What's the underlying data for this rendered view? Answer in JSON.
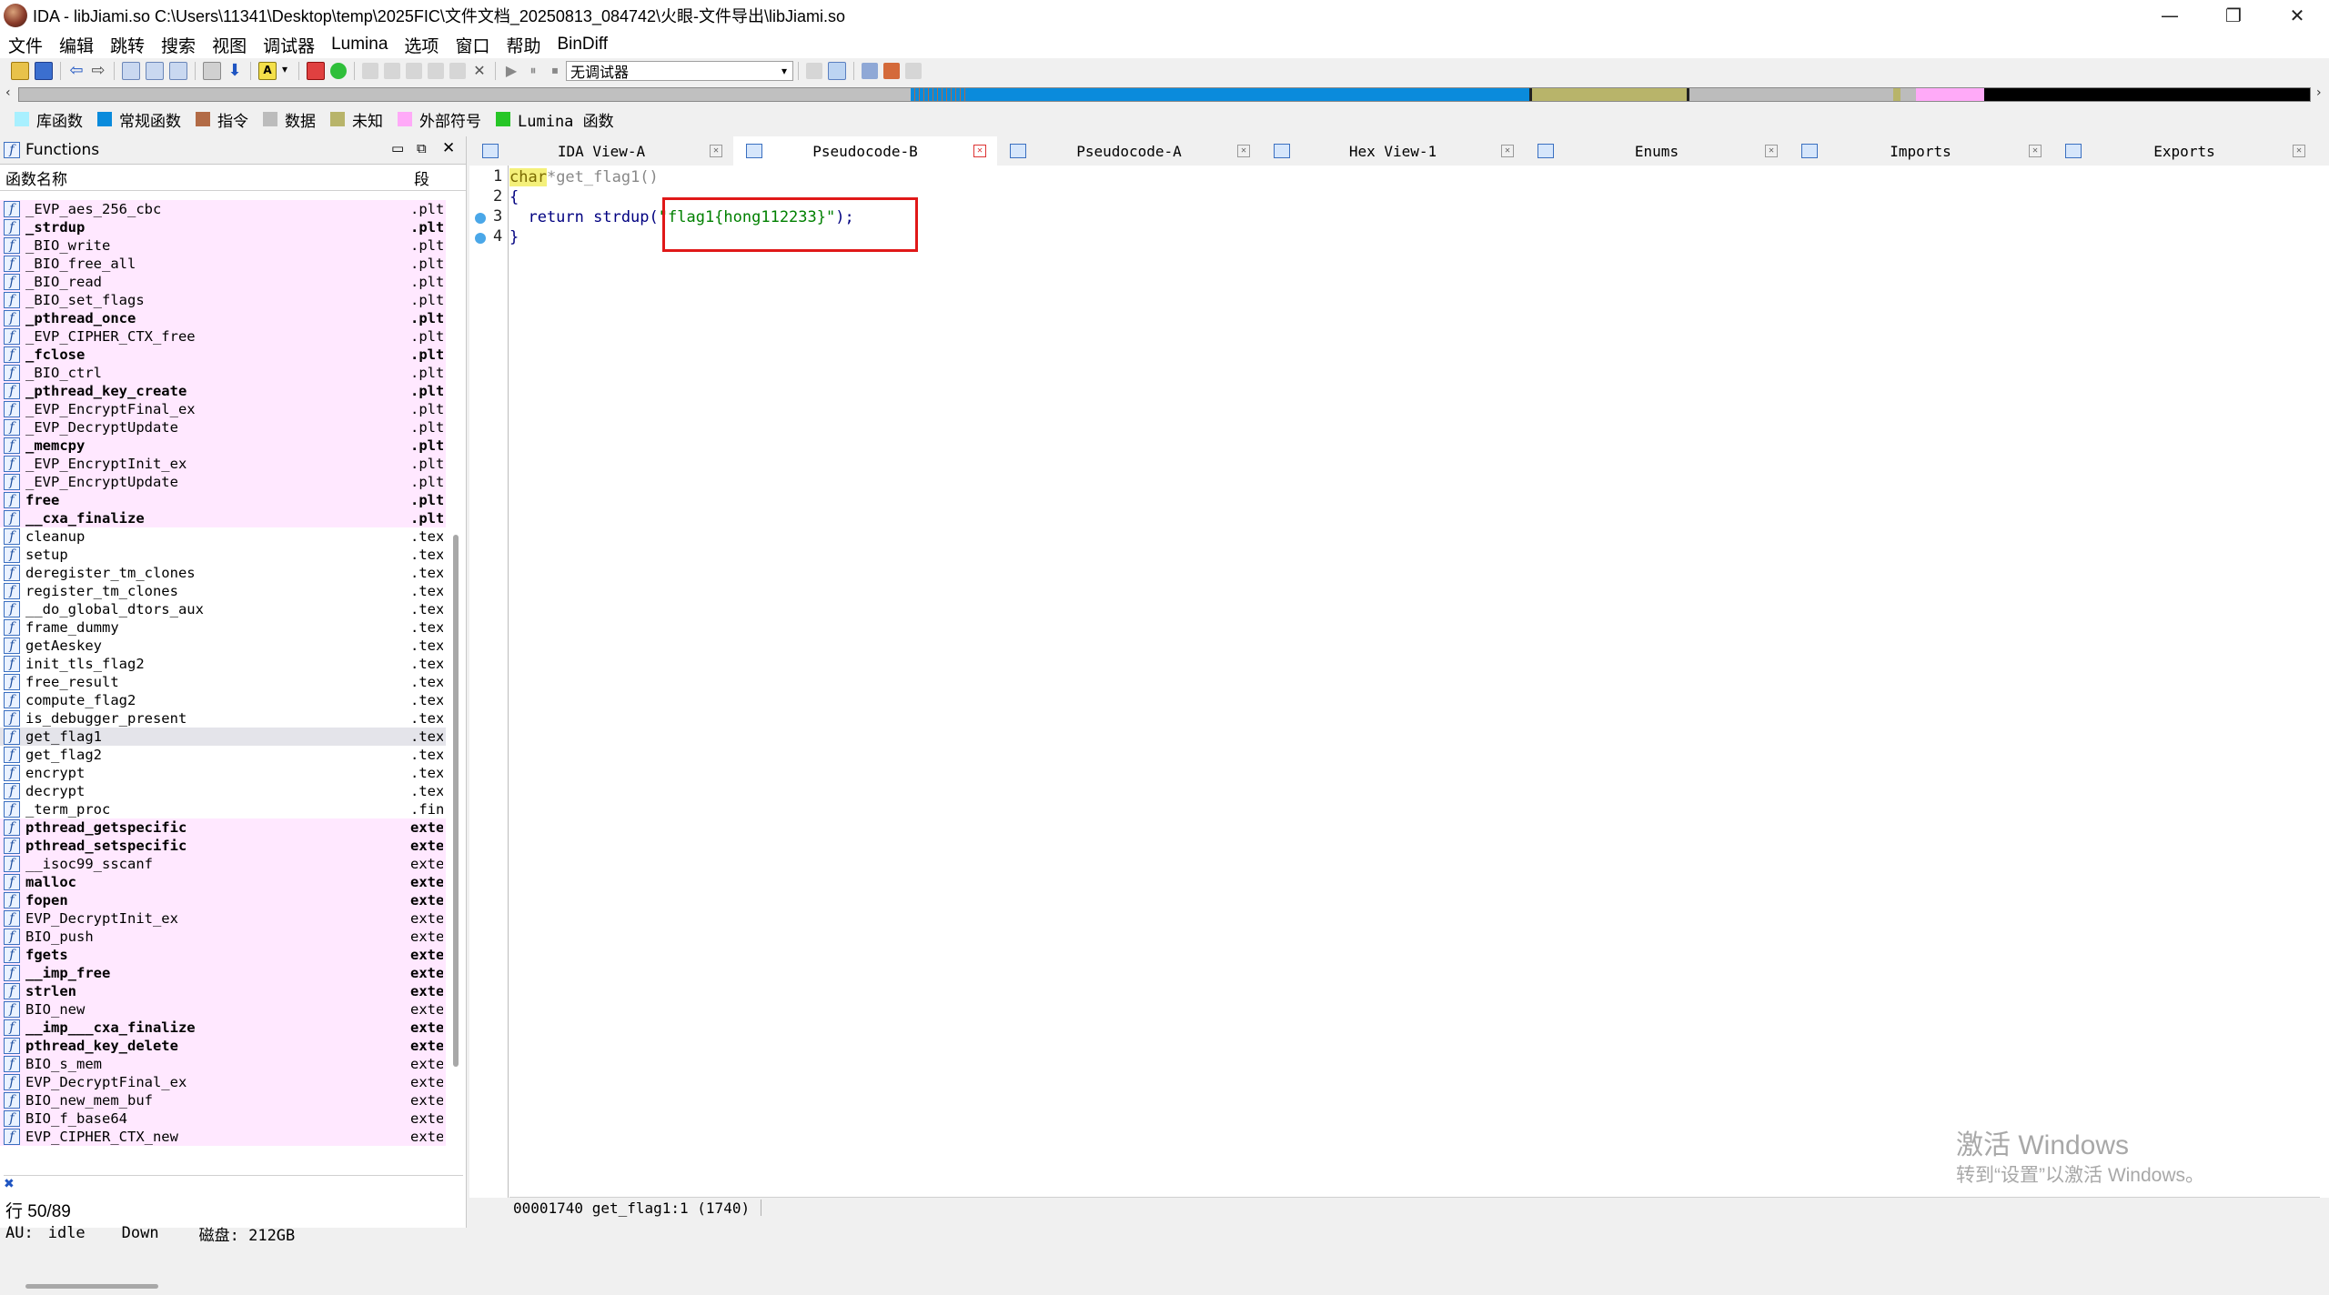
{
  "window": {
    "title": "IDA - libJiami.so C:\\Users\\11341\\Desktop\\temp\\2025FIC\\文件文档_20250813_084742\\火眼-文件导出\\libJiami.so",
    "min_glyph": "—",
    "max_glyph": "❐",
    "close_glyph": "✕"
  },
  "menu": [
    "文件",
    "编辑",
    "跳转",
    "搜索",
    "视图",
    "调试器",
    "Lumina",
    "选项",
    "窗口",
    "帮助",
    "BinDiff"
  ],
  "toolbar": {
    "debugger_select": "无调试器",
    "icons": [
      "open-icon",
      "save-icon",
      "back-icon",
      "forward-icon",
      "copy-icon",
      "jump-icon",
      "run-icon",
      "pause-icon",
      "stop-icon"
    ]
  },
  "legend": [
    {
      "label": "库函数",
      "color": "#a8f0ff"
    },
    {
      "label": "常规函数",
      "color": "#0a8bdc"
    },
    {
      "label": "指令",
      "color": "#b26b46"
    },
    {
      "label": "数据",
      "color": "#bcbcbc"
    },
    {
      "label": "未知",
      "color": "#b8b46a"
    },
    {
      "label": "外部符号",
      "color": "#ffaaf8"
    },
    {
      "label": "Lumina 函数",
      "color": "#27c627"
    }
  ],
  "functions_panel": {
    "title": "Functions",
    "col_name": "函数名称",
    "col_segment": "段",
    "rows": [
      {
        "name": "_EVP_aes_256_cbc",
        "seg": ".plt",
        "bold": false,
        "pink": true
      },
      {
        "name": "_strdup",
        "seg": ".plt",
        "bold": true,
        "pink": true
      },
      {
        "name": "_BIO_write",
        "seg": ".plt",
        "bold": false,
        "pink": true
      },
      {
        "name": "_BIO_free_all",
        "seg": ".plt",
        "bold": false,
        "pink": true
      },
      {
        "name": "_BIO_read",
        "seg": ".plt",
        "bold": false,
        "pink": true
      },
      {
        "name": "_BIO_set_flags",
        "seg": ".plt",
        "bold": false,
        "pink": true
      },
      {
        "name": "_pthread_once",
        "seg": ".plt",
        "bold": true,
        "pink": true
      },
      {
        "name": "_EVP_CIPHER_CTX_free",
        "seg": ".plt",
        "bold": false,
        "pink": true
      },
      {
        "name": "_fclose",
        "seg": ".plt",
        "bold": true,
        "pink": true
      },
      {
        "name": "_BIO_ctrl",
        "seg": ".plt",
        "bold": false,
        "pink": true
      },
      {
        "name": "_pthread_key_create",
        "seg": ".plt",
        "bold": true,
        "pink": true
      },
      {
        "name": "_EVP_EncryptFinal_ex",
        "seg": ".plt",
        "bold": false,
        "pink": true
      },
      {
        "name": "_EVP_DecryptUpdate",
        "seg": ".plt",
        "bold": false,
        "pink": true
      },
      {
        "name": "_memcpy",
        "seg": ".plt",
        "bold": true,
        "pink": true
      },
      {
        "name": "_EVP_EncryptInit_ex",
        "seg": ".plt",
        "bold": false,
        "pink": true
      },
      {
        "name": "_EVP_EncryptUpdate",
        "seg": ".plt",
        "bold": false,
        "pink": true
      },
      {
        "name": "free",
        "seg": ".plt",
        "bold": true,
        "pink": true
      },
      {
        "name": "__cxa_finalize",
        "seg": ".plt",
        "bold": true,
        "pink": true
      },
      {
        "name": "cleanup",
        "seg": ".text",
        "bold": false,
        "pink": false
      },
      {
        "name": "setup",
        "seg": ".text",
        "bold": false,
        "pink": false
      },
      {
        "name": "deregister_tm_clones",
        "seg": ".text",
        "bold": false,
        "pink": false
      },
      {
        "name": "register_tm_clones",
        "seg": ".text",
        "bold": false,
        "pink": false
      },
      {
        "name": "__do_global_dtors_aux",
        "seg": ".text",
        "bold": false,
        "pink": false
      },
      {
        "name": "frame_dummy",
        "seg": ".text",
        "bold": false,
        "pink": false
      },
      {
        "name": "getAeskey",
        "seg": ".text",
        "bold": false,
        "pink": false
      },
      {
        "name": "init_tls_flag2",
        "seg": ".text",
        "bold": false,
        "pink": false
      },
      {
        "name": "free_result",
        "seg": ".text",
        "bold": false,
        "pink": false
      },
      {
        "name": "compute_flag2",
        "seg": ".text",
        "bold": false,
        "pink": false
      },
      {
        "name": "is_debugger_present",
        "seg": ".text",
        "bold": false,
        "pink": false
      },
      {
        "name": "get_flag1",
        "seg": ".text",
        "bold": false,
        "pink": false,
        "selected": true
      },
      {
        "name": "get_flag2",
        "seg": ".text",
        "bold": false,
        "pink": false
      },
      {
        "name": "encrypt",
        "seg": ".text",
        "bold": false,
        "pink": false
      },
      {
        "name": "decrypt",
        "seg": ".text",
        "bold": false,
        "pink": false
      },
      {
        "name": "_term_proc",
        "seg": ".fini",
        "bold": false,
        "pink": false
      },
      {
        "name": "pthread_getspecific",
        "seg": "extern",
        "bold": true,
        "pink": true
      },
      {
        "name": "pthread_setspecific",
        "seg": "extern",
        "bold": true,
        "pink": true
      },
      {
        "name": "__isoc99_sscanf",
        "seg": "extern",
        "bold": false,
        "pink": true
      },
      {
        "name": "malloc",
        "seg": "extern",
        "bold": true,
        "pink": true
      },
      {
        "name": "fopen",
        "seg": "extern",
        "bold": true,
        "pink": true
      },
      {
        "name": "EVP_DecryptInit_ex",
        "seg": "extern",
        "bold": false,
        "pink": true
      },
      {
        "name": "BIO_push",
        "seg": "extern",
        "bold": false,
        "pink": true
      },
      {
        "name": "fgets",
        "seg": "extern",
        "bold": true,
        "pink": true
      },
      {
        "name": "__imp_free",
        "seg": "extern",
        "bold": true,
        "pink": true
      },
      {
        "name": "strlen",
        "seg": "extern",
        "bold": true,
        "pink": true
      },
      {
        "name": "BIO_new",
        "seg": "extern",
        "bold": false,
        "pink": true
      },
      {
        "name": "__imp___cxa_finalize",
        "seg": "extern",
        "bold": true,
        "pink": true
      },
      {
        "name": "pthread_key_delete",
        "seg": "extern",
        "bold": true,
        "pink": true
      },
      {
        "name": "BIO_s_mem",
        "seg": "extern",
        "bold": false,
        "pink": true
      },
      {
        "name": "EVP_DecryptFinal_ex",
        "seg": "extern",
        "bold": false,
        "pink": true
      },
      {
        "name": "BIO_new_mem_buf",
        "seg": "extern",
        "bold": false,
        "pink": true
      },
      {
        "name": "BIO_f_base64",
        "seg": "extern",
        "bold": false,
        "pink": true
      },
      {
        "name": "EVP_CIPHER_CTX_new",
        "seg": "extern",
        "bold": false,
        "pink": true
      }
    ],
    "line_status": "行 50/89"
  },
  "tabs": [
    {
      "label": "IDA View-A",
      "active": false
    },
    {
      "label": "Pseudocode-B",
      "active": true
    },
    {
      "label": "Pseudocode-A",
      "active": false
    },
    {
      "label": "Hex View-1",
      "active": false
    },
    {
      "label": "Enums",
      "active": false
    },
    {
      "label": "Imports",
      "active": false
    },
    {
      "label": "Exports",
      "active": false
    }
  ],
  "code": {
    "line1": {
      "num": "1",
      "kw": "char",
      "rest": " *get_flag1()"
    },
    "line2": {
      "num": "2",
      "text": "{"
    },
    "line3": {
      "num": "3",
      "pre": "  return strdup(",
      "str": "\"flag1{hong112233}\"",
      "post": ");"
    },
    "line4": {
      "num": "4",
      "text": "}"
    },
    "status": "00001740 get_flag1:1 (1740)"
  },
  "bottom_status": {
    "au": "AU:",
    "state": "idle",
    "dir": "Down",
    "disk": "磁盘: 212GB"
  },
  "watermark": {
    "line1": "激活 Windows",
    "line2": "转到“设置”以激活 Windows。"
  }
}
